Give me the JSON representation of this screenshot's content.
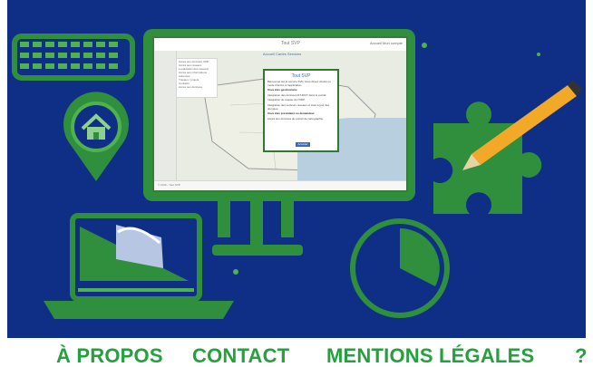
{
  "embedded_screen": {
    "logo_text": "Tout SVP",
    "top_links": "Accueil   Mon compte",
    "tabs": "Accueil   Cartes   Services",
    "menu_items": [
      "Accès aux données ODP",
      "Accès aux réseaux",
      "Localisation des réseaux",
      "Accès aux informations",
      "Adresses",
      "Travaux / projets",
      "Contacts",
      "Accès aux données"
    ],
    "dialog": {
      "logo": "Tout SVP",
      "intro": "Bienvenue sur le service SVP. Vous devez choisir un mode d'accès à l'application.",
      "section1": "Vous êtes gestionnaire",
      "line1": "Intégration des données DT-DICT dans le portail.",
      "line2": "Intégration du réseau de l'ODP.",
      "line3": "Intégration des vecteurs reseaux et mise à jour des données.",
      "section2": "Vous êtes prestataire ou demandeur",
      "line4": "Accès aux données du portail de cartographie.",
      "button": "Accéder"
    },
    "status": "© 2016 - Tout SVP"
  },
  "footer": {
    "items": [
      {
        "label": "À PROPOS"
      },
      {
        "label": "CONTACT"
      },
      {
        "label": "MENTIONS LÉGALES"
      },
      {
        "label": "?"
      }
    ]
  },
  "colors": {
    "background": "#0f2f86",
    "illustration_green": "#2f8f3c",
    "illustration_green_light": "#4fb24f",
    "nav_text": "#23a13c",
    "pencil": "#f3a928"
  }
}
